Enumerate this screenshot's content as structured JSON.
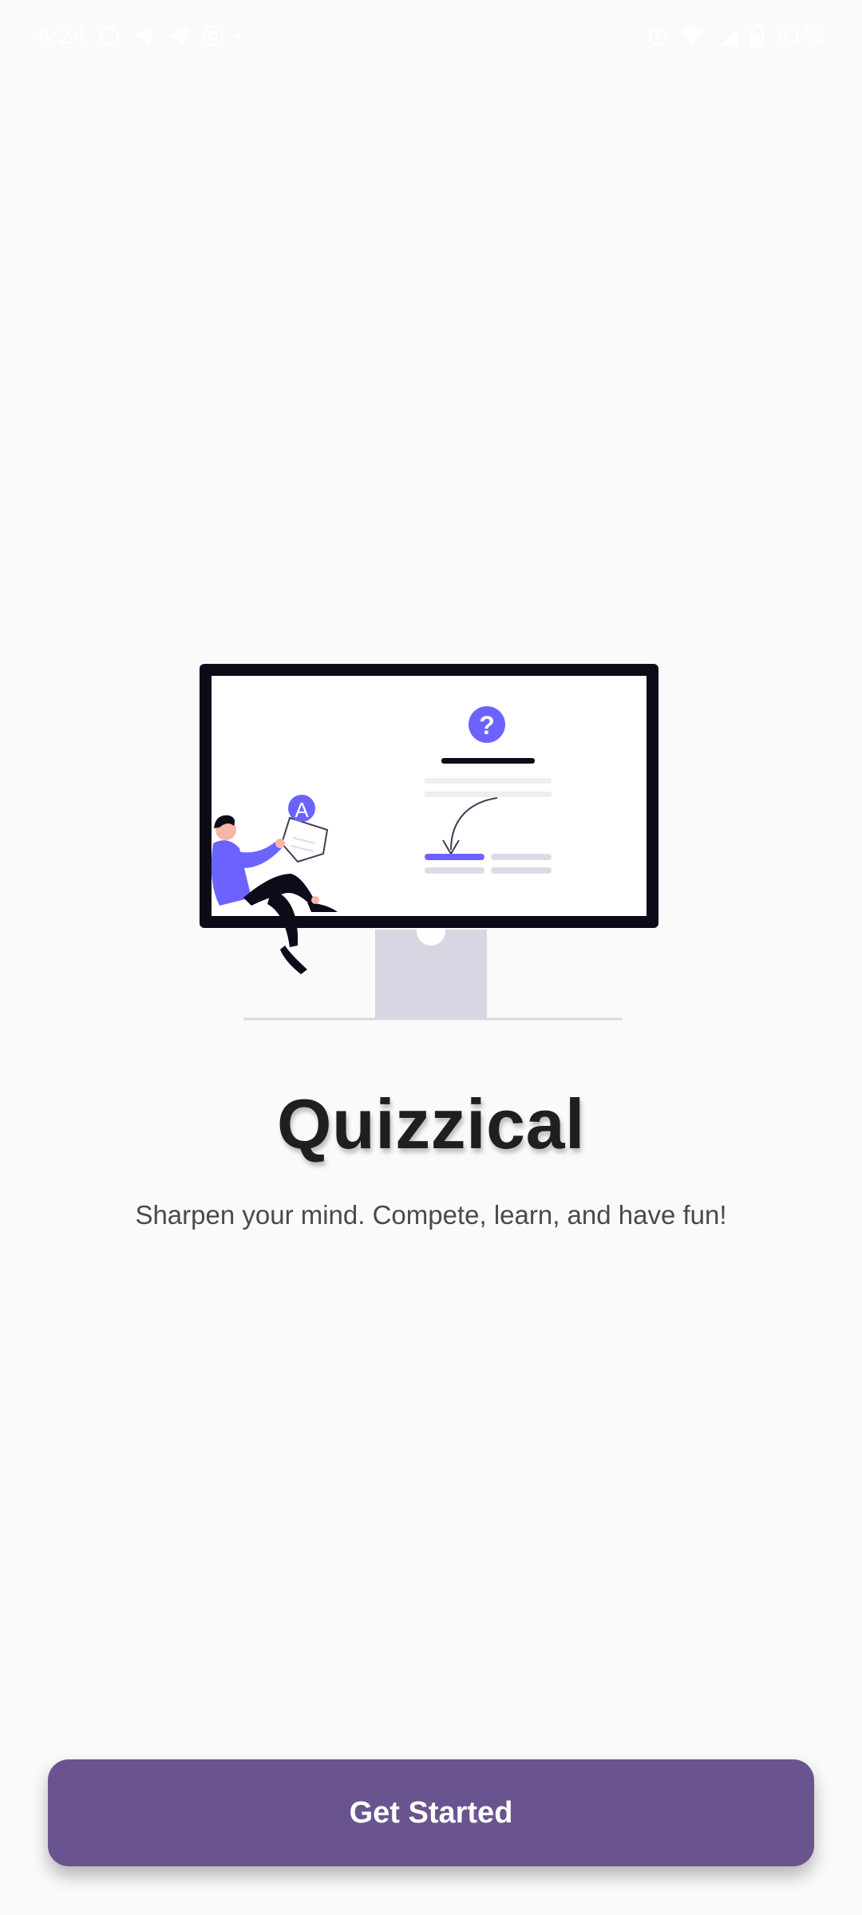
{
  "status_bar": {
    "time": "4:24",
    "battery": "61%",
    "left_icons": [
      "whatsapp-icon",
      "telegram-icon",
      "telegram-icon",
      "instagram-icon",
      "dot"
    ],
    "right_icons": [
      "alarm-icon",
      "wifi-icon",
      "signal-icon",
      "battery-icon"
    ]
  },
  "illustration": {
    "name": "quiz-monitor-illustration",
    "accent_color": "#6c63ff",
    "badge_letter": "A",
    "question_mark": "?"
  },
  "main": {
    "title": "Quizzical",
    "subtitle": "Sharpen your mind. Compete, learn, and have fun!"
  },
  "actions": {
    "get_started_label": "Get Started"
  },
  "colors": {
    "background": "#fafafa",
    "button": "#6a548f",
    "accent": "#6c63ff",
    "title": "#1f1f1f"
  }
}
